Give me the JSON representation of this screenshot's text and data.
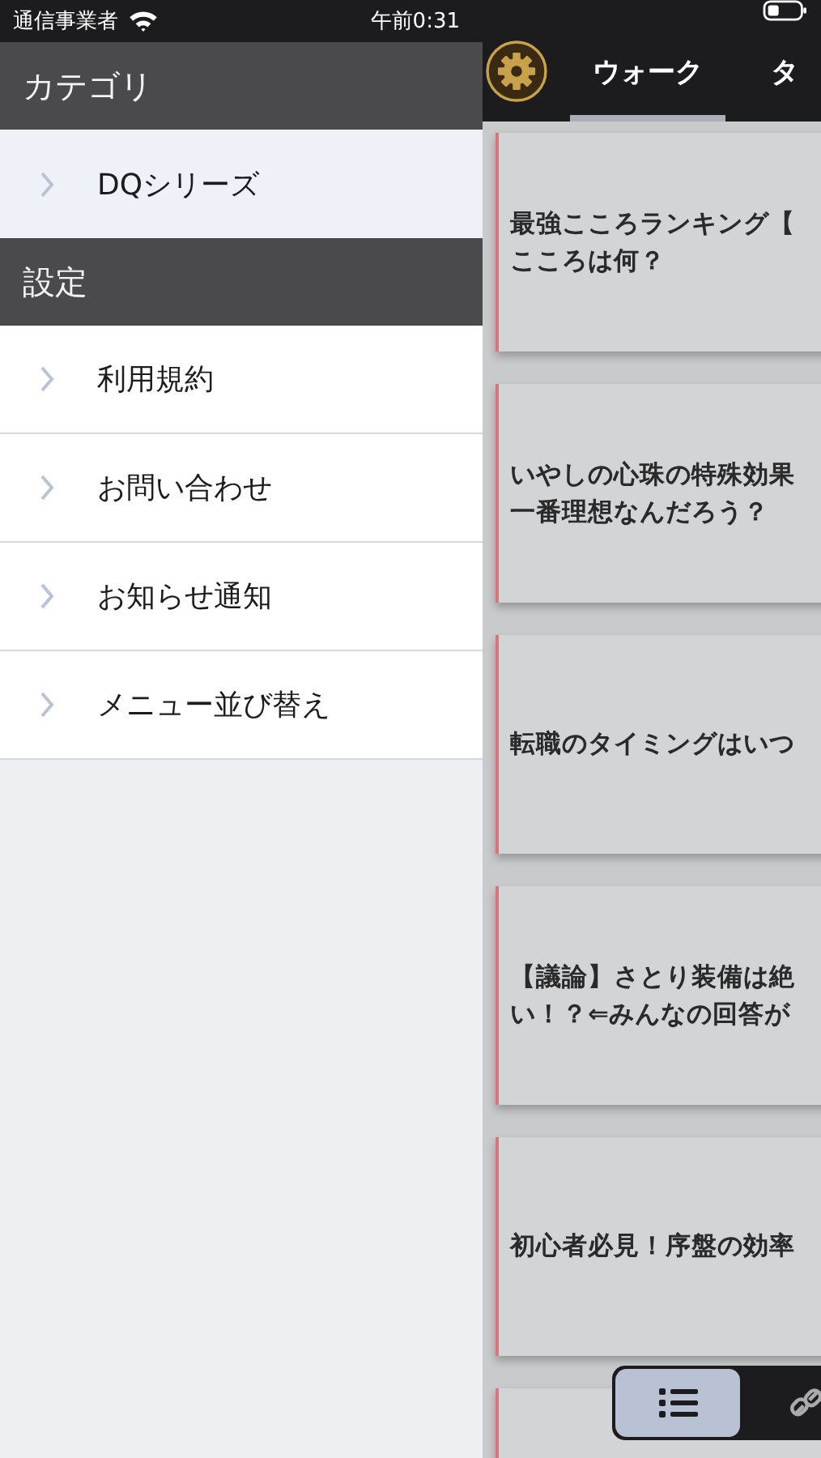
{
  "status_bar": {
    "carrier": "通信事業者",
    "time": "午前0:31"
  },
  "sidebar": {
    "sections": [
      {
        "title": "カテゴリ",
        "items": [
          {
            "label": "DQシリーズ",
            "selected": true
          }
        ]
      },
      {
        "title": "設定",
        "items": [
          {
            "label": "利用規約",
            "selected": false
          },
          {
            "label": "お問い合わせ",
            "selected": false
          },
          {
            "label": "お知らせ通知",
            "selected": false
          },
          {
            "label": "メニュー並び替え",
            "selected": false
          }
        ]
      }
    ]
  },
  "main": {
    "tabs": [
      {
        "label": "ウォーク",
        "selected": true
      },
      {
        "label": "タ",
        "selected": false
      }
    ],
    "articles": [
      {
        "lines": [
          "最強こころランキング【",
          "こころは何？"
        ]
      },
      {
        "lines": [
          "いやしの心珠の特殊効果",
          "一番理想なんだろう？"
        ]
      },
      {
        "lines": [
          "転職のタイミングはいつ"
        ]
      },
      {
        "lines": [
          "【議論】さとり装備は絶",
          "い！？⇐みんなの回答が"
        ]
      },
      {
        "lines": [
          "初心者必見！序盤の効率"
        ]
      }
    ],
    "view_switch": [
      {
        "kind": "list",
        "selected": true
      },
      {
        "kind": "link",
        "selected": false
      }
    ]
  }
}
